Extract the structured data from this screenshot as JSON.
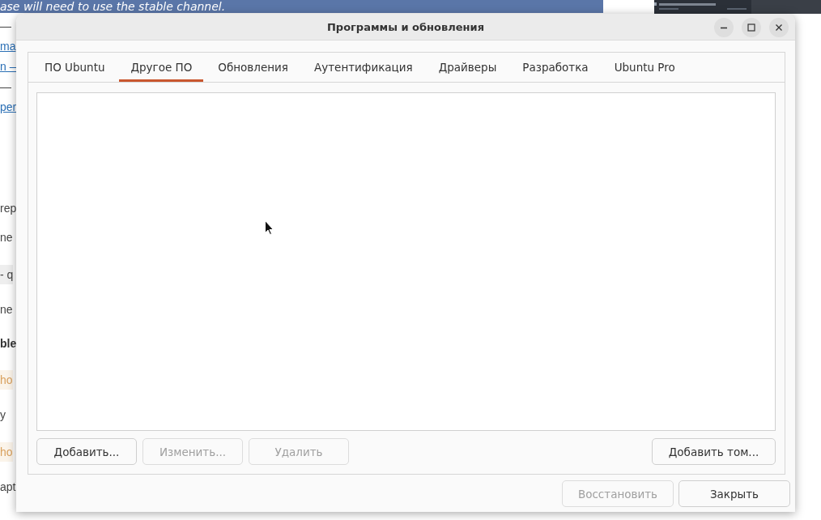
{
  "background_page": {
    "banner_text": "ase will need to use the stable channel.",
    "fragments": [
      {
        "text": "—",
        "kind": "text"
      },
      {
        "text": "ma",
        "kind": "link"
      },
      {
        "text": "n —",
        "kind": "link"
      },
      {
        "text": "—",
        "kind": "text"
      },
      {
        "text": "per",
        "kind": "link"
      },
      {
        "text": "rep",
        "kind": "text"
      },
      {
        "text": "ne",
        "kind": "text"
      },
      {
        "text": "- q",
        "kind": "code"
      },
      {
        "text": "ne",
        "kind": "text"
      },
      {
        "text": "ble",
        "kind": "bold"
      },
      {
        "text": "ho",
        "kind": "highlight"
      },
      {
        "text": "y",
        "kind": "text"
      },
      {
        "text": "ho",
        "kind": "highlight"
      },
      {
        "text": "apt",
        "kind": "text"
      }
    ]
  },
  "window": {
    "title": "Программы и обновления"
  },
  "tabs": [
    {
      "label": "ПО Ubuntu",
      "selected": false
    },
    {
      "label": "Другое ПО",
      "selected": true
    },
    {
      "label": "Обновления",
      "selected": false
    },
    {
      "label": "Аутентификация",
      "selected": false
    },
    {
      "label": "Драйверы",
      "selected": false
    },
    {
      "label": "Разработка",
      "selected": false
    },
    {
      "label": "Ubuntu Pro",
      "selected": false
    }
  ],
  "list_buttons": [
    {
      "label": "Добавить...",
      "disabled": false
    },
    {
      "label": "Изменить...",
      "disabled": true
    },
    {
      "label": "Удалить",
      "disabled": true
    }
  ],
  "add_volume_button": {
    "label": "Добавить том...",
    "disabled": false
  },
  "dialog_buttons": [
    {
      "label": "Восстановить",
      "disabled": true
    },
    {
      "label": "Закрыть",
      "disabled": false
    }
  ]
}
